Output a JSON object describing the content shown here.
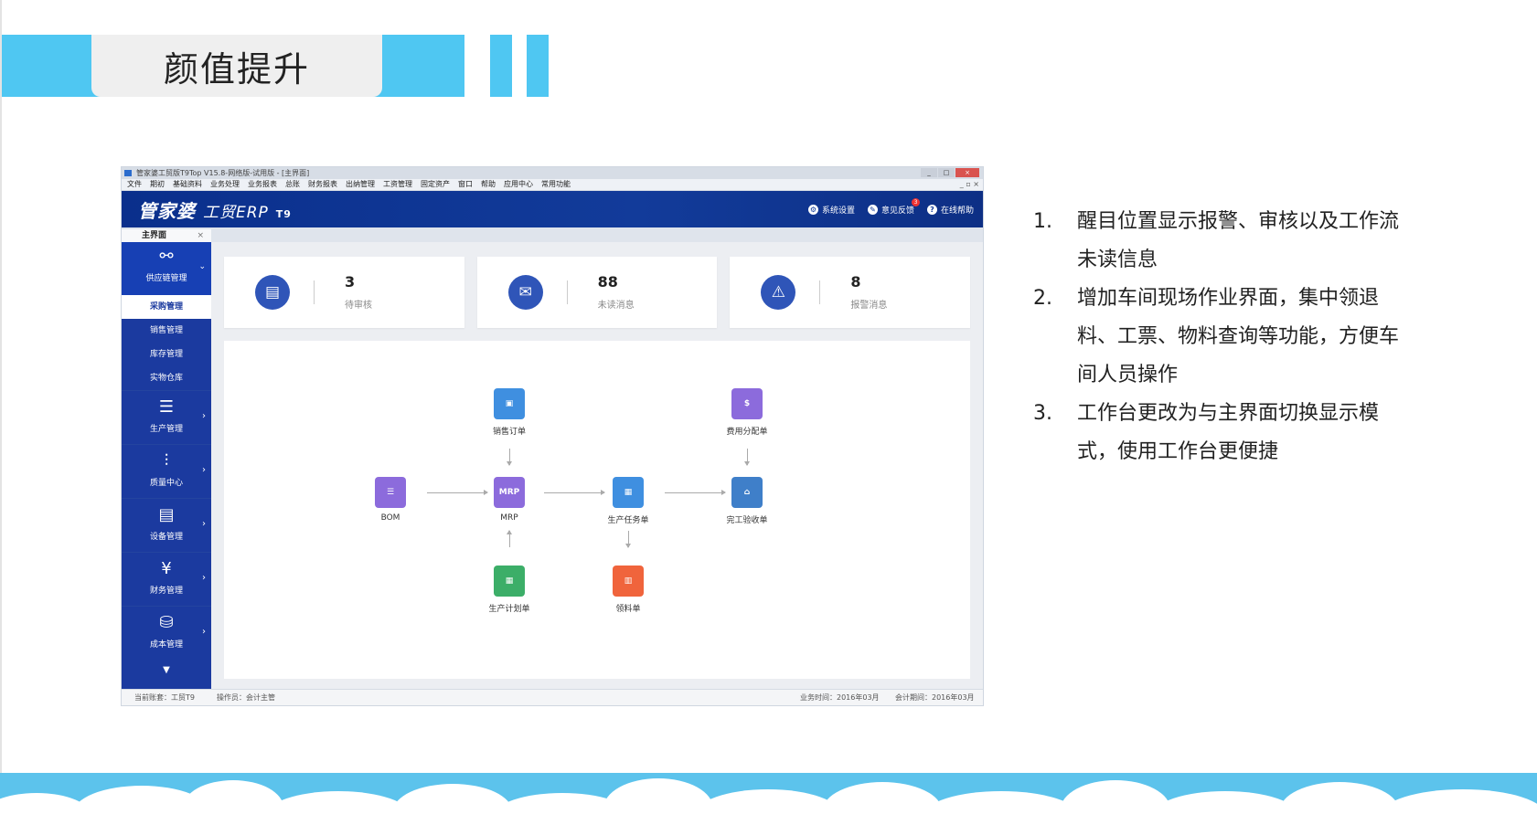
{
  "slide": {
    "title": "颜值提升",
    "notes": [
      {
        "num": "1.",
        "text": "醒目位置显示报警、审核以及工作流未读信息"
      },
      {
        "num": "2.",
        "text": "增加车间现场作业界面，集中领退料、工票、物料查询等功能，方便车间人员操作"
      },
      {
        "num": "3.",
        "text": "工作台更改为与主界面切换显示模式，使用工作台更便捷"
      }
    ],
    "accent_color": "#4fc7f2"
  },
  "erp": {
    "window_title": "管家婆工贸版T9Top V15.8-网络版-试用版 - [主界面]",
    "menu": [
      "文件",
      "期初",
      "基础资料",
      "业务处理",
      "业务报表",
      "总账",
      "财务报表",
      "出纳管理",
      "工资管理",
      "固定资产",
      "窗口",
      "帮助",
      "应用中心",
      "常用功能"
    ],
    "brand": {
      "main": "管家婆",
      "sub": "工贸ERP",
      "edition": "T9"
    },
    "tools": {
      "settings": "系统设置",
      "feedback": "意见反馈",
      "feedback_badge": "3",
      "help": "在线帮助"
    },
    "tab": {
      "label": "主界面",
      "close": "×"
    },
    "sidebar": {
      "group": {
        "label": "供应链管理",
        "icon": "network-icon"
      },
      "subitems": [
        "采购管理",
        "销售管理",
        "库存管理",
        "实物仓库"
      ],
      "items": [
        {
          "label": "生产管理",
          "icon": "sliders-icon"
        },
        {
          "label": "质量中心",
          "icon": "chart-icon"
        },
        {
          "label": "设备管理",
          "icon": "server-icon"
        },
        {
          "label": "财务管理",
          "icon": "finance-icon"
        },
        {
          "label": "成本管理",
          "icon": "database-icon"
        }
      ],
      "more": "▼"
    },
    "cards": [
      {
        "num": "3",
        "label": "待审核",
        "icon": "audit-icon"
      },
      {
        "num": "88",
        "label": "未读消息",
        "icon": "mail-icon"
      },
      {
        "num": "8",
        "label": "报警消息",
        "icon": "alarm-icon"
      }
    ],
    "flow": {
      "bom": "BOM",
      "mrp": "MRP",
      "sales_order": "销售订单",
      "production_plan": "生产计划单",
      "production_task": "生产任务单",
      "material_requisition": "领料单",
      "completion_acceptance": "完工验收单",
      "cost_allocation": "费用分配单",
      "colors": {
        "bom": "#8c6bdc",
        "mrp": "#8c6bdc",
        "sales": "#3f8fe0",
        "plan": "#3cae68",
        "task": "#3f8fe0",
        "material": "#f0643c",
        "acceptance": "#3f7fc9",
        "cost": "#8c6bdc"
      }
    },
    "status": {
      "account": "当前账套：工贸T9",
      "operator": "操作员：会计主管",
      "business_time": "业务时间：2016年03月",
      "accounting_period": "会计期间：2016年03月"
    }
  }
}
